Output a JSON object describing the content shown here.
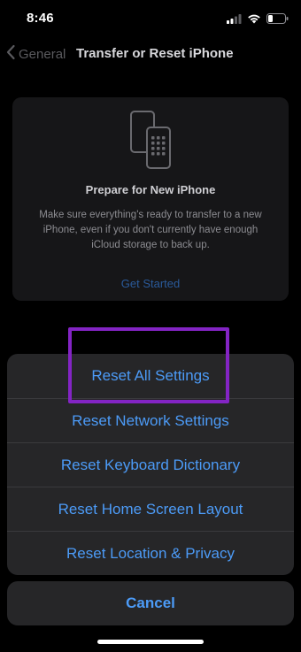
{
  "status_bar": {
    "time": "8:46",
    "icons": [
      "cellular-signal-icon",
      "wifi-icon",
      "battery-icon"
    ]
  },
  "nav": {
    "back_label": "General",
    "title": "Transfer or Reset iPhone",
    "back_icon": "chevron-left-icon"
  },
  "prepare_card": {
    "icon": "phones-transfer-icon",
    "title": "Prepare for New iPhone",
    "description": "Make sure everything's ready to transfer to a new iPhone, even if you don't currently have enough iCloud storage to back up.",
    "link_label": "Get Started"
  },
  "action_sheet": {
    "items": [
      {
        "label": "Reset All Settings",
        "highlighted": true
      },
      {
        "label": "Reset Network Settings"
      },
      {
        "label": "Reset Keyboard Dictionary"
      },
      {
        "label": "Reset Home Screen Layout"
      },
      {
        "label": "Reset Location & Privacy"
      }
    ],
    "cancel_label": "Cancel"
  },
  "colors": {
    "accent": "#4c9bf7",
    "highlight": "#8324c4",
    "sheet_background": "#262628",
    "background": "#000000"
  }
}
